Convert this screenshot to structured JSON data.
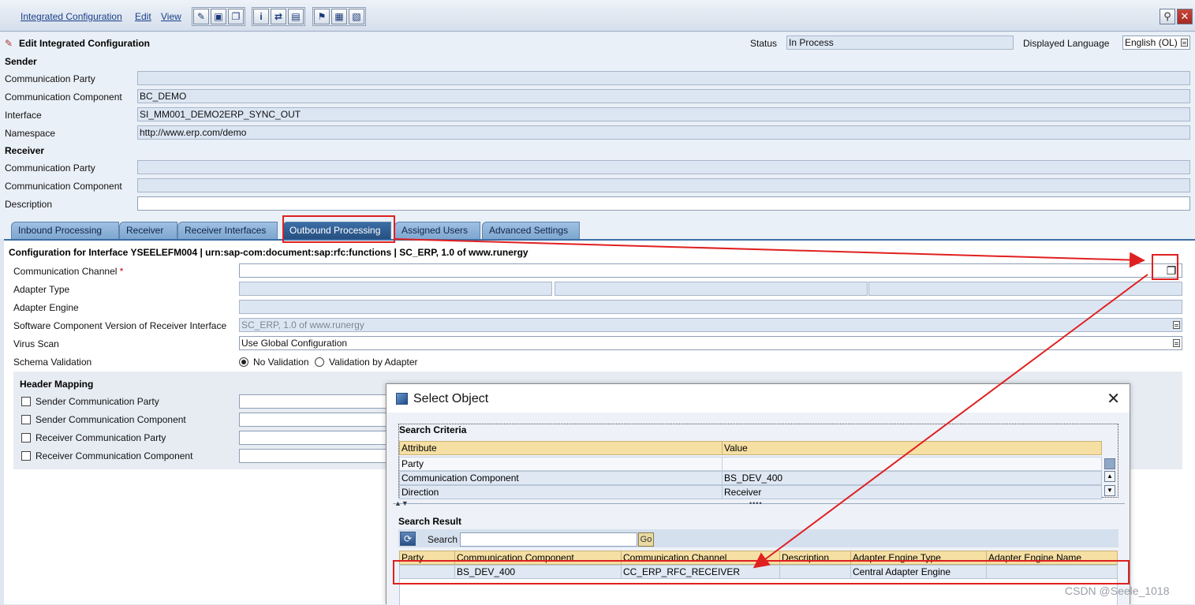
{
  "menu": {
    "items": [
      "Integrated Configuration",
      "Edit",
      "View"
    ]
  },
  "header": {
    "title": "Edit Integrated Configuration",
    "status_label": "Status",
    "status_value": "In Process",
    "language_label": "Displayed Language",
    "language_value": "English (OL)"
  },
  "sender": {
    "section": "Sender",
    "rows": [
      {
        "label": "Communication Party",
        "value": ""
      },
      {
        "label": "Communication Component",
        "value": "BC_DEMO"
      },
      {
        "label": "Interface",
        "value": "SI_MM001_DEMO2ERP_SYNC_OUT"
      },
      {
        "label": "Namespace",
        "value": "http://www.erp.com/demo"
      }
    ]
  },
  "receiver": {
    "section": "Receiver",
    "rows": [
      {
        "label": "Communication Party",
        "value": ""
      },
      {
        "label": "Communication Component",
        "value": ""
      },
      {
        "label": "Description",
        "value": ""
      }
    ]
  },
  "tabs": [
    "Inbound Processing",
    "Receiver",
    "Receiver Interfaces",
    "Outbound Processing",
    "Assigned Users",
    "Advanced Settings"
  ],
  "outbound": {
    "config_title": "Configuration for Interface YSEELEFM004 | urn:sap-com:document:sap:rfc:functions | SC_ERP, 1.0 of www.runergy",
    "comm_channel_label": "Communication Channel",
    "required_mark": "*",
    "adapter_type_label": "Adapter Type",
    "adapter_engine_label": "Adapter Engine",
    "swcv_label": "Software Component Version of Receiver Interface",
    "swcv_value": "SC_ERP, 1.0 of www.runergy",
    "virus_scan_label": "Virus Scan",
    "virus_scan_value": "Use Global Configuration",
    "schema_validation_label": "Schema Validation",
    "schema_options": [
      "No Validation",
      "Validation by Adapter"
    ],
    "header_mapping_title": "Header Mapping",
    "header_mapping_rows": [
      "Sender Communication Party",
      "Sender Communication Component",
      "Receiver Communication Party",
      "Receiver Communication Component"
    ]
  },
  "dialog": {
    "title": "Select Object",
    "criteria_title": "Search Criteria",
    "criteria_headers": [
      "Attribute",
      "Value"
    ],
    "criteria_rows": [
      [
        "Party",
        ""
      ],
      [
        "Communication Component",
        "BS_DEV_400"
      ],
      [
        "Direction",
        "Receiver"
      ]
    ],
    "result_title": "Search Result",
    "search_label": "Search",
    "search_value": "",
    "go_label": "Go",
    "result_headers": [
      "Party",
      "Communication Component",
      "Communication Channel",
      "Description",
      "Adapter Engine Type",
      "Adapter Engine Name"
    ],
    "result_rows": [
      [
        "",
        "BS_DEV_400",
        "CC_ERP_RFC_RECEIVER",
        "",
        "Central Adapter Engine",
        ""
      ]
    ]
  },
  "watermark": "CSDN @Seele_1018",
  "colors": {
    "annotation": "#e02020",
    "active_tab": "#3b6ea5",
    "grid_header": "#f5dfa3"
  }
}
